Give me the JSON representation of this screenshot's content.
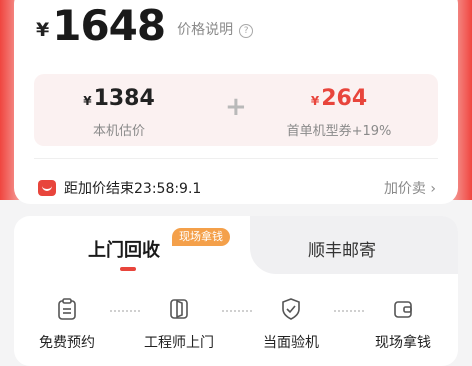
{
  "price": {
    "currency": "¥",
    "amount": "1648",
    "explain": "价格说明",
    "help_icon": "?"
  },
  "breakdown": {
    "left": {
      "currency": "¥",
      "value": "1384",
      "label": "本机估价"
    },
    "plus": "+",
    "right": {
      "currency": "¥",
      "value": "264",
      "label": "首单机型券+19%",
      "color": "#e8453c"
    }
  },
  "countdown": {
    "text": "距加价结束23:58:9.1",
    "action": "加价卖",
    "chevron": "›"
  },
  "tabs": {
    "active": {
      "label": "上门回收",
      "tag": "现场拿钱"
    },
    "inactive": {
      "label": "顺丰邮寄"
    }
  },
  "steps": [
    {
      "icon": "clipboard-icon",
      "label": "免费预约"
    },
    {
      "icon": "door-icon",
      "label": "工程师上门"
    },
    {
      "icon": "shield-check-icon",
      "label": "当面验机"
    },
    {
      "icon": "wallet-icon",
      "label": "现场拿钱"
    }
  ],
  "colors": {
    "accent": "#e8453c",
    "tag": "#f4a04a"
  }
}
